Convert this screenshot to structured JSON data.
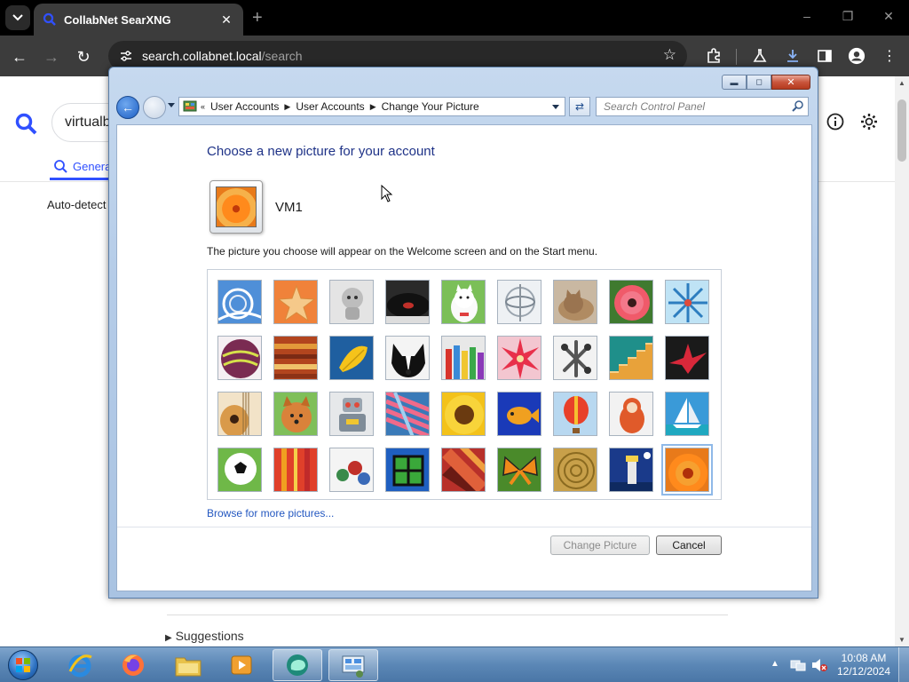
{
  "browser": {
    "tab_title": "CollabNet SearXNG",
    "tab_close": "✕",
    "new_tab": "+",
    "url_host": "search.collabnet.local",
    "url_path": "/search",
    "accent": "#3050ff"
  },
  "searx": {
    "query": "virtualb",
    "tab_general": "Genera",
    "auto_detect": "Auto-detect",
    "suggestions": "Suggestions"
  },
  "control_panel": {
    "breadcrumbs": [
      "User Accounts",
      "User Accounts",
      "Change Your Picture"
    ],
    "search_placeholder": "Search Control Panel",
    "heading": "Choose a new picture for your account",
    "username": "VM1",
    "description": "The picture you choose will appear on the Welcome screen and on the Start menu.",
    "browse_link": "Browse for more pictures...",
    "change_button": "Change Picture",
    "cancel_button": "Cancel",
    "pictures": [
      "roller-coaster",
      "starfish",
      "robot-toy",
      "record-player",
      "lucky-cat",
      "gyroscope",
      "kitten",
      "pink-flower",
      "pinwheel",
      "ball",
      "fabric",
      "leaf",
      "dog",
      "crayons",
      "star-lantern",
      "jacks",
      "stairs",
      "paper-crane",
      "guitar",
      "puppy",
      "tin-robot",
      "yarn",
      "sunflower",
      "fish",
      "hot-air-balloon",
      "matryoshka",
      "sailboat",
      "soccer-ball",
      "stripes-fabric",
      "marbles",
      "green-frame",
      "tapestry",
      "butterfly",
      "woven-basket",
      "lighthouse",
      "orange-flower"
    ],
    "selected_picture": "orange-flower"
  },
  "taskbar": {
    "time": "10:08 AM",
    "date": "12/12/2024",
    "apps": [
      "internet-explorer",
      "firefox",
      "file-explorer",
      "media-player",
      "chat-app",
      "control-panel"
    ]
  }
}
